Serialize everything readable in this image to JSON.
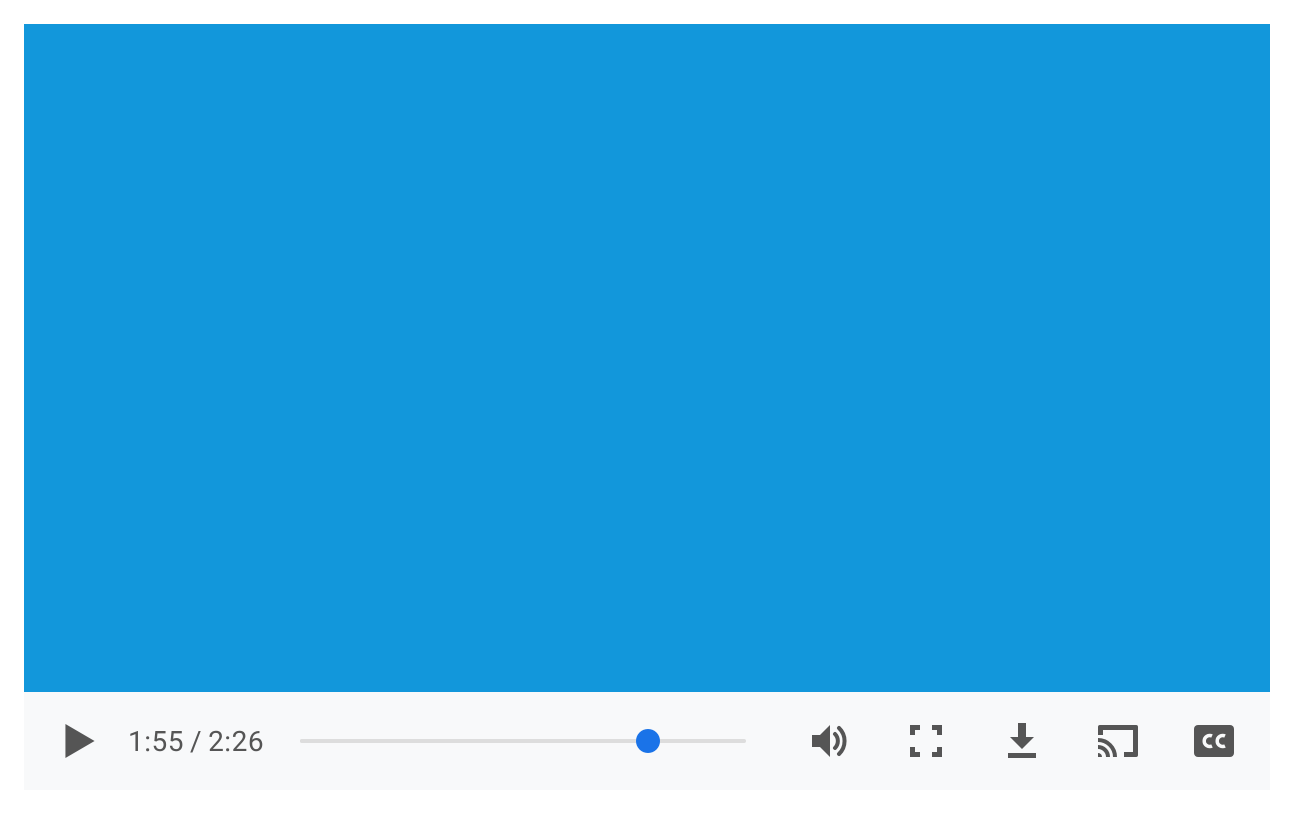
{
  "colors": {
    "canvas_bg": "#1297db",
    "controls_bg": "#f8f9fa",
    "icon_color": "#555555",
    "accent": "#1a73e8"
  },
  "playback": {
    "current_time": "1:55",
    "duration": "2:26",
    "progress_percent": 78,
    "playing": false
  },
  "icons": {
    "play": "play-icon",
    "volume": "volume-icon",
    "fullscreen": "fullscreen-icon",
    "download": "download-icon",
    "cast": "cast-icon",
    "cc": "closed-captions-icon"
  },
  "controls": {
    "time_separator": "/",
    "cc_label": "CC"
  }
}
